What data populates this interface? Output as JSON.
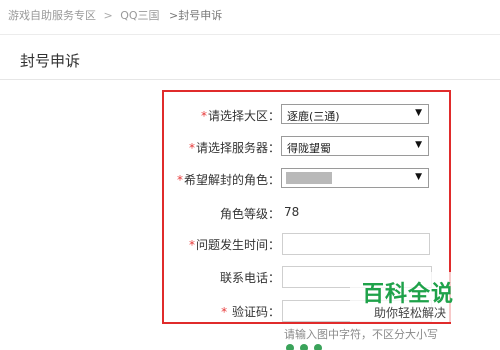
{
  "breadcrumb": {
    "items": [
      "游戏自助服务专区",
      "QQ三国"
    ],
    "separator": ">",
    "current": ">封号申诉"
  },
  "page": {
    "title": "封号申诉"
  },
  "form": {
    "required_mark": "*",
    "region": {
      "label": "请选择大区：",
      "value": "逐鹿(三通)",
      "arrow": "▼"
    },
    "server": {
      "label": "请选择服务器：",
      "value": "得陇望蜀",
      "arrow": "▼"
    },
    "role": {
      "label": "希望解封的角色：",
      "value_redacted": true,
      "arrow": "▼"
    },
    "level": {
      "label": "角色等级：",
      "value": "78"
    },
    "time": {
      "label": "问题发生时间：",
      "value": ""
    },
    "phone": {
      "label": "联系电话：",
      "value": ""
    },
    "captcha": {
      "label": "验证码：",
      "value": "",
      "hint": "请输入图中字符，不区分大小写"
    }
  },
  "watermark": {
    "title": "百科全说",
    "subtitle": "助你轻松解决"
  },
  "colors": {
    "highlight_border": "#e02b2b",
    "required_star": "#e83a3a",
    "watermark_green": "#1fa24a"
  }
}
